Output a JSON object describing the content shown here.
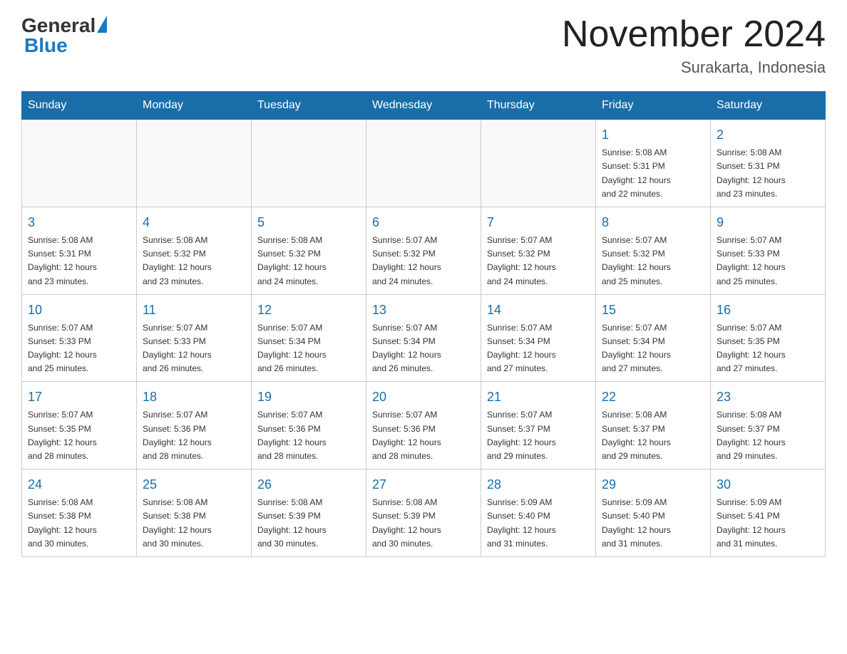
{
  "header": {
    "title": "November 2024",
    "subtitle": "Surakarta, Indonesia",
    "logo_general": "General",
    "logo_blue": "Blue"
  },
  "weekdays": [
    "Sunday",
    "Monday",
    "Tuesday",
    "Wednesday",
    "Thursday",
    "Friday",
    "Saturday"
  ],
  "weeks": [
    [
      {
        "day": "",
        "info": ""
      },
      {
        "day": "",
        "info": ""
      },
      {
        "day": "",
        "info": ""
      },
      {
        "day": "",
        "info": ""
      },
      {
        "day": "",
        "info": ""
      },
      {
        "day": "1",
        "info": "Sunrise: 5:08 AM\nSunset: 5:31 PM\nDaylight: 12 hours\nand 22 minutes."
      },
      {
        "day": "2",
        "info": "Sunrise: 5:08 AM\nSunset: 5:31 PM\nDaylight: 12 hours\nand 23 minutes."
      }
    ],
    [
      {
        "day": "3",
        "info": "Sunrise: 5:08 AM\nSunset: 5:31 PM\nDaylight: 12 hours\nand 23 minutes."
      },
      {
        "day": "4",
        "info": "Sunrise: 5:08 AM\nSunset: 5:32 PM\nDaylight: 12 hours\nand 23 minutes."
      },
      {
        "day": "5",
        "info": "Sunrise: 5:08 AM\nSunset: 5:32 PM\nDaylight: 12 hours\nand 24 minutes."
      },
      {
        "day": "6",
        "info": "Sunrise: 5:07 AM\nSunset: 5:32 PM\nDaylight: 12 hours\nand 24 minutes."
      },
      {
        "day": "7",
        "info": "Sunrise: 5:07 AM\nSunset: 5:32 PM\nDaylight: 12 hours\nand 24 minutes."
      },
      {
        "day": "8",
        "info": "Sunrise: 5:07 AM\nSunset: 5:32 PM\nDaylight: 12 hours\nand 25 minutes."
      },
      {
        "day": "9",
        "info": "Sunrise: 5:07 AM\nSunset: 5:33 PM\nDaylight: 12 hours\nand 25 minutes."
      }
    ],
    [
      {
        "day": "10",
        "info": "Sunrise: 5:07 AM\nSunset: 5:33 PM\nDaylight: 12 hours\nand 25 minutes."
      },
      {
        "day": "11",
        "info": "Sunrise: 5:07 AM\nSunset: 5:33 PM\nDaylight: 12 hours\nand 26 minutes."
      },
      {
        "day": "12",
        "info": "Sunrise: 5:07 AM\nSunset: 5:34 PM\nDaylight: 12 hours\nand 26 minutes."
      },
      {
        "day": "13",
        "info": "Sunrise: 5:07 AM\nSunset: 5:34 PM\nDaylight: 12 hours\nand 26 minutes."
      },
      {
        "day": "14",
        "info": "Sunrise: 5:07 AM\nSunset: 5:34 PM\nDaylight: 12 hours\nand 27 minutes."
      },
      {
        "day": "15",
        "info": "Sunrise: 5:07 AM\nSunset: 5:34 PM\nDaylight: 12 hours\nand 27 minutes."
      },
      {
        "day": "16",
        "info": "Sunrise: 5:07 AM\nSunset: 5:35 PM\nDaylight: 12 hours\nand 27 minutes."
      }
    ],
    [
      {
        "day": "17",
        "info": "Sunrise: 5:07 AM\nSunset: 5:35 PM\nDaylight: 12 hours\nand 28 minutes."
      },
      {
        "day": "18",
        "info": "Sunrise: 5:07 AM\nSunset: 5:36 PM\nDaylight: 12 hours\nand 28 minutes."
      },
      {
        "day": "19",
        "info": "Sunrise: 5:07 AM\nSunset: 5:36 PM\nDaylight: 12 hours\nand 28 minutes."
      },
      {
        "day": "20",
        "info": "Sunrise: 5:07 AM\nSunset: 5:36 PM\nDaylight: 12 hours\nand 28 minutes."
      },
      {
        "day": "21",
        "info": "Sunrise: 5:07 AM\nSunset: 5:37 PM\nDaylight: 12 hours\nand 29 minutes."
      },
      {
        "day": "22",
        "info": "Sunrise: 5:08 AM\nSunset: 5:37 PM\nDaylight: 12 hours\nand 29 minutes."
      },
      {
        "day": "23",
        "info": "Sunrise: 5:08 AM\nSunset: 5:37 PM\nDaylight: 12 hours\nand 29 minutes."
      }
    ],
    [
      {
        "day": "24",
        "info": "Sunrise: 5:08 AM\nSunset: 5:38 PM\nDaylight: 12 hours\nand 30 minutes."
      },
      {
        "day": "25",
        "info": "Sunrise: 5:08 AM\nSunset: 5:38 PM\nDaylight: 12 hours\nand 30 minutes."
      },
      {
        "day": "26",
        "info": "Sunrise: 5:08 AM\nSunset: 5:39 PM\nDaylight: 12 hours\nand 30 minutes."
      },
      {
        "day": "27",
        "info": "Sunrise: 5:08 AM\nSunset: 5:39 PM\nDaylight: 12 hours\nand 30 minutes."
      },
      {
        "day": "28",
        "info": "Sunrise: 5:09 AM\nSunset: 5:40 PM\nDaylight: 12 hours\nand 31 minutes."
      },
      {
        "day": "29",
        "info": "Sunrise: 5:09 AM\nSunset: 5:40 PM\nDaylight: 12 hours\nand 31 minutes."
      },
      {
        "day": "30",
        "info": "Sunrise: 5:09 AM\nSunset: 5:41 PM\nDaylight: 12 hours\nand 31 minutes."
      }
    ]
  ]
}
